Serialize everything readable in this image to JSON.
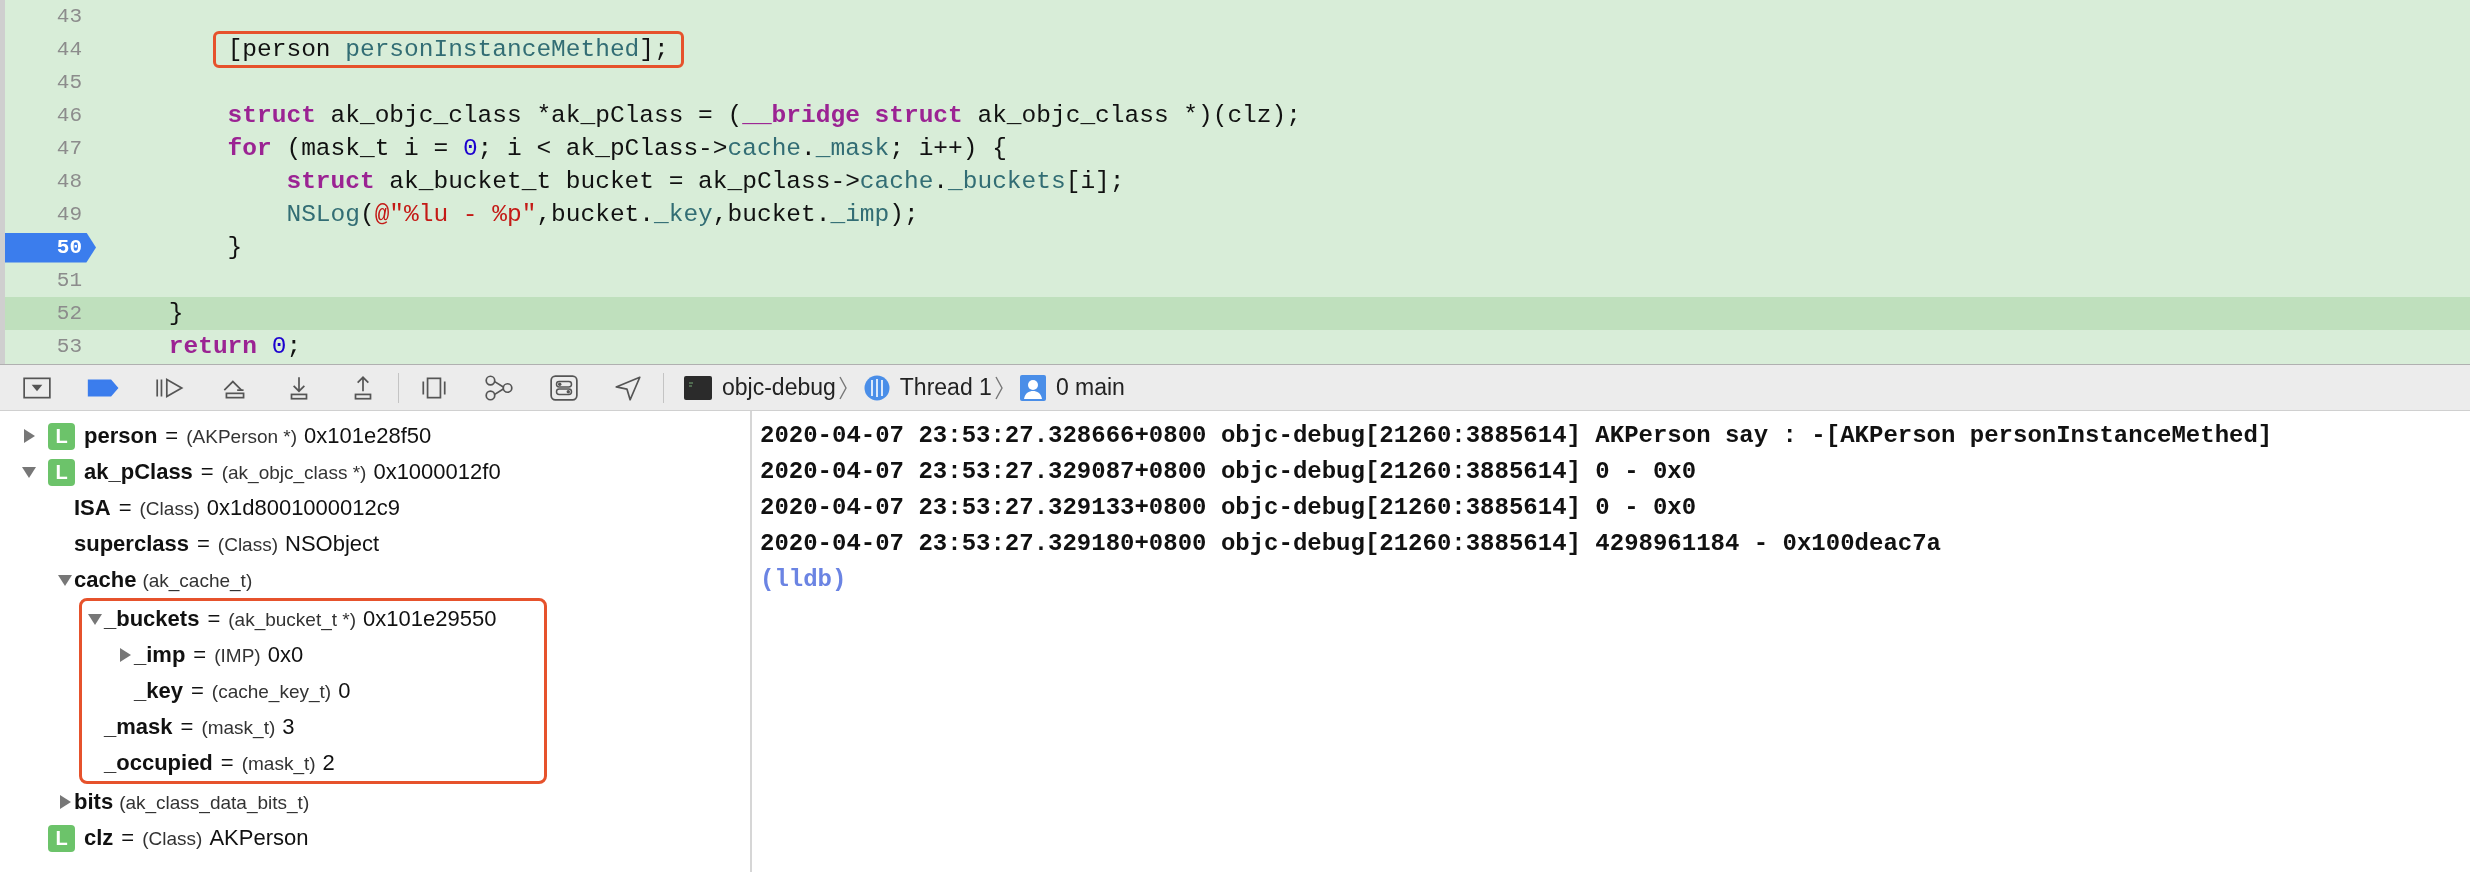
{
  "editor": {
    "lines": [
      {
        "number": "43",
        "current": false,
        "highlighted": false
      },
      {
        "number": "44",
        "current": false,
        "highlighted": false,
        "annotated": true,
        "tokens": [
          {
            "text": "        [person ",
            "kind": "plain"
          },
          {
            "text": "personInstanceMethed",
            "kind": "member"
          },
          {
            "text": "];",
            "kind": "plain"
          }
        ]
      },
      {
        "number": "45",
        "current": false,
        "highlighted": false
      },
      {
        "number": "46",
        "current": false,
        "highlighted": false,
        "tokens": [
          {
            "text": "        struct",
            "kind": "keyword"
          },
          {
            "text": " ak_objc_class *ak_pClass = (",
            "kind": "plain"
          },
          {
            "text": "__bridge struct",
            "kind": "keyword"
          },
          {
            "text": " ak_objc_class *)(clz);",
            "kind": "plain"
          }
        ]
      },
      {
        "number": "47",
        "current": false,
        "highlighted": false,
        "tokens": [
          {
            "text": "        for",
            "kind": "keyword"
          },
          {
            "text": " (mask_t i = ",
            "kind": "plain"
          },
          {
            "text": "0",
            "kind": "number"
          },
          {
            "text": "; i < ak_pClass->",
            "kind": "plain"
          },
          {
            "text": "cache",
            "kind": "member"
          },
          {
            "text": ".",
            "kind": "plain"
          },
          {
            "text": "_mask",
            "kind": "member"
          },
          {
            "text": "; i++) {",
            "kind": "plain"
          }
        ]
      },
      {
        "number": "48",
        "current": false,
        "highlighted": false,
        "tokens": [
          {
            "text": "            struct",
            "kind": "keyword"
          },
          {
            "text": " ak_bucket_t bucket = ak_pClass->",
            "kind": "plain"
          },
          {
            "text": "cache",
            "kind": "member"
          },
          {
            "text": ".",
            "kind": "plain"
          },
          {
            "text": "_buckets",
            "kind": "member"
          },
          {
            "text": "[i];",
            "kind": "plain"
          }
        ]
      },
      {
        "number": "49",
        "current": false,
        "highlighted": false,
        "tokens": [
          {
            "text": "            NSLog",
            "kind": "member"
          },
          {
            "text": "(",
            "kind": "plain"
          },
          {
            "text": "@\"%lu - %p\"",
            "kind": "string"
          },
          {
            "text": ",bucket.",
            "kind": "plain"
          },
          {
            "text": "_key",
            "kind": "member"
          },
          {
            "text": ",bucket.",
            "kind": "plain"
          },
          {
            "text": "_imp",
            "kind": "member"
          },
          {
            "text": ");",
            "kind": "plain"
          }
        ]
      },
      {
        "number": "50",
        "current": true,
        "highlighted": false,
        "tokens": [
          {
            "text": "        }",
            "kind": "plain"
          }
        ]
      },
      {
        "number": "51",
        "current": false,
        "highlighted": false
      },
      {
        "number": "52",
        "current": false,
        "highlighted": true,
        "tokens": [
          {
            "text": "    }",
            "kind": "plain"
          }
        ]
      },
      {
        "number": "53",
        "current": false,
        "highlighted": false,
        "tokens": [
          {
            "text": "    return",
            "kind": "keyword"
          },
          {
            "text": " 0",
            "kind": "number"
          },
          {
            "text": ";",
            "kind": "plain"
          }
        ]
      }
    ]
  },
  "debug_bar": {
    "breakpoints_active": true,
    "breadcrumbs": [
      {
        "kind": "process",
        "label": "objc-debug"
      },
      {
        "kind": "thread",
        "label": "Thread 1"
      },
      {
        "kind": "frame",
        "label": "0 main"
      }
    ]
  },
  "variables": [
    {
      "badge": "L",
      "name": "person",
      "separator": "=",
      "type": "(AKPerson *)",
      "value": "0x101e28f50",
      "expanded": false
    },
    {
      "badge": "L",
      "name": "ak_pClass",
      "separator": "=",
      "type": "(ak_objc_class *)",
      "value": "0x1000012f0",
      "expanded": true,
      "children": [
        {
          "name": "ISA",
          "separator": "=",
          "type": "(Class)",
          "value": "0x1d8001000012c9"
        },
        {
          "name": "superclass",
          "separator": "=",
          "type": "(Class)",
          "value": "NSObject"
        },
        {
          "name": "cache",
          "type": "(ak_cache_t)",
          "expanded": true,
          "annotated": true,
          "children": [
            {
              "name": "_buckets",
              "separator": "=",
              "type": "(ak_bucket_t *)",
              "value": "0x101e29550",
              "expanded": true,
              "children": [
                {
                  "name": "_imp",
                  "separator": "=",
                  "type": "(IMP)",
                  "value": "0x0",
                  "expanded": false
                },
                {
                  "name": "_key",
                  "separator": "=",
                  "type": "(cache_key_t)",
                  "value": "0"
                }
              ]
            },
            {
              "name": "_mask",
              "separator": "=",
              "type": "(mask_t)",
              "value": "3"
            },
            {
              "name": "_occupied",
              "separator": "=",
              "type": "(mask_t)",
              "value": "2"
            }
          ]
        },
        {
          "name": "bits",
          "type": "(ak_class_data_bits_t)",
          "expanded": false
        }
      ]
    },
    {
      "badge": "L",
      "name": "clz",
      "separator": "=",
      "type": "(Class)",
      "value": "AKPerson"
    }
  ],
  "console": {
    "lines": [
      {
        "kind": "output",
        "text": "2020-04-07 23:53:27.328666+0800 objc-debug[21260:3885614] AKPerson say : -[AKPerson personInstanceMethed]"
      },
      {
        "kind": "output",
        "text": "2020-04-07 23:53:27.329087+0800 objc-debug[21260:3885614] 0 - 0x0"
      },
      {
        "kind": "output",
        "text": "2020-04-07 23:53:27.329133+0800 objc-debug[21260:3885614] 0 - 0x0"
      },
      {
        "kind": "output",
        "text": "2020-04-07 23:53:27.329180+0800 objc-debug[21260:3885614] 4298961184 - 0x100deac7a"
      },
      {
        "kind": "prompt",
        "text": "(lldb)"
      }
    ]
  }
}
